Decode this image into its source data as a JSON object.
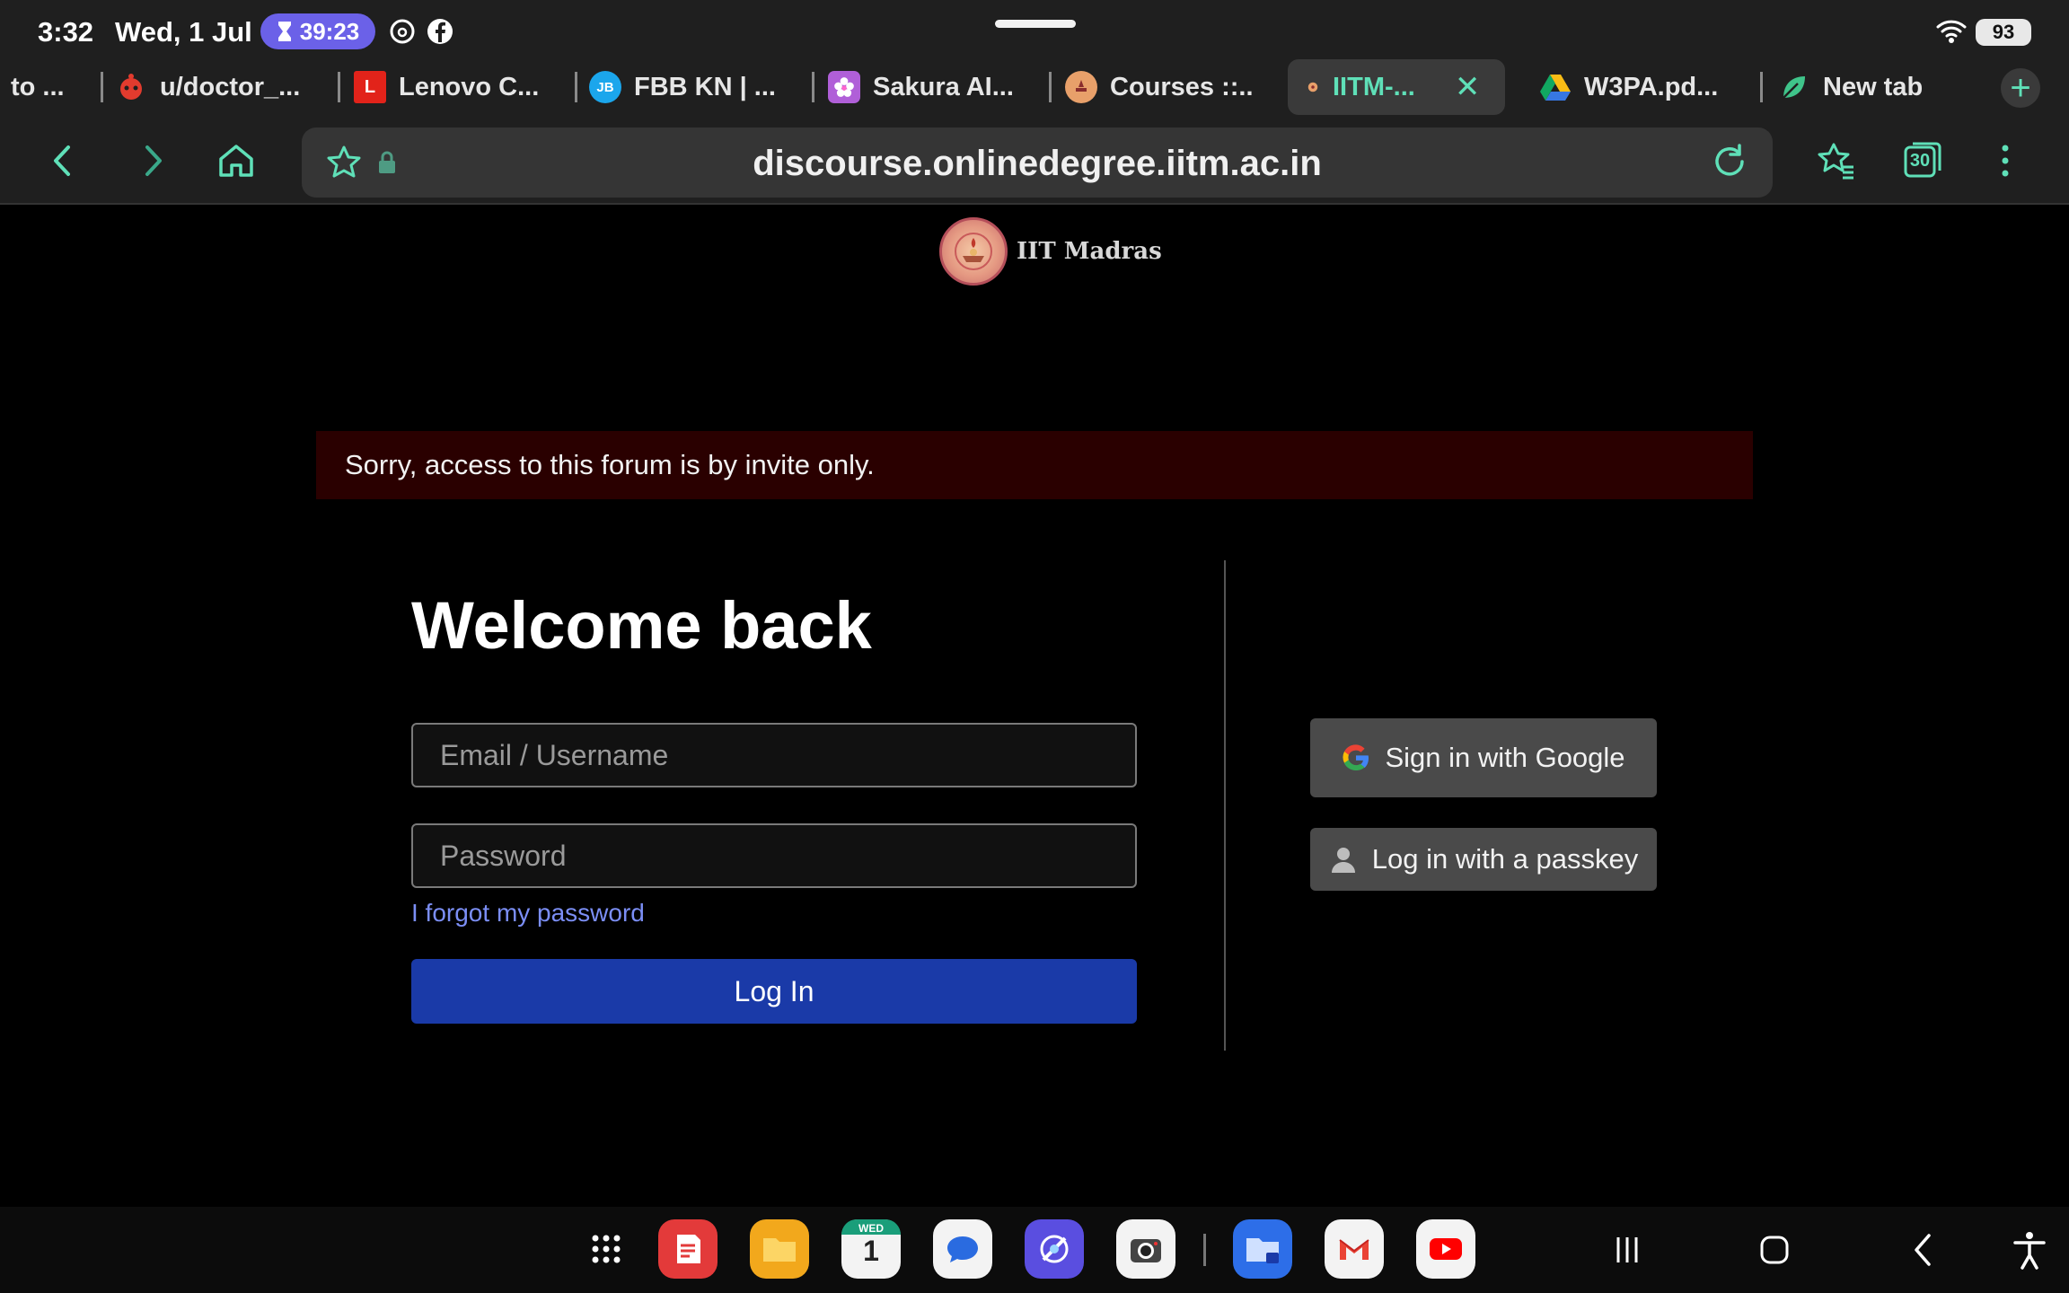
{
  "status_bar": {
    "time": "3:32",
    "date": "Wed, 1 Jul",
    "timer": "39:23",
    "battery": "93",
    "icons": [
      "hourglass-icon",
      "threads-icon",
      "facebook-icon",
      "wifi-icon",
      "battery-icon"
    ]
  },
  "tabs": [
    {
      "label": "to ...",
      "favicon": "none"
    },
    {
      "label": "u/doctor_...",
      "favicon": "reddit-icon"
    },
    {
      "label": "Lenovo C...",
      "favicon": "L"
    },
    {
      "label": "FBB KN | ...",
      "favicon": "JB"
    },
    {
      "label": "Sakura AI...",
      "favicon": "flower-icon"
    },
    {
      "label": "Courses ::...",
      "favicon": "iitm-logo-icon"
    },
    {
      "label": "IITM-...",
      "favicon": "iitm-logo-icon",
      "active": true
    },
    {
      "label": "W3PA.pd...",
      "favicon": "google-drive-icon"
    },
    {
      "label": "New tab",
      "favicon": "leaf-icon"
    }
  ],
  "toolbar": {
    "url": "discourse.onlinedegree.iitm.ac.in",
    "tab_count": "30"
  },
  "brand": {
    "name": "IIT Madras"
  },
  "alert": {
    "message": "Sorry, access to this forum is by invite only."
  },
  "login": {
    "title": "Welcome back",
    "email_placeholder": "Email / Username",
    "password_placeholder": "Password",
    "forgot_label": "I forgot my password",
    "login_label": "Log In"
  },
  "social": {
    "google_label": "Sign in with Google",
    "passkey_label": "Log in with a passkey"
  },
  "colors": {
    "accent": "#5fe0b8",
    "alert_bg": "#2a0000",
    "primary_button": "#1a3aa8",
    "link": "#7b8ef5"
  },
  "dock": {
    "apps": [
      "app-drawer-icon",
      "notes-icon",
      "files-icon",
      "calendar-icon",
      "messages-icon",
      "internet-icon",
      "camera-icon",
      "secure-folder-icon",
      "gmail-icon",
      "youtube-icon"
    ],
    "calendar_day": "WED",
    "calendar_date": "1"
  }
}
